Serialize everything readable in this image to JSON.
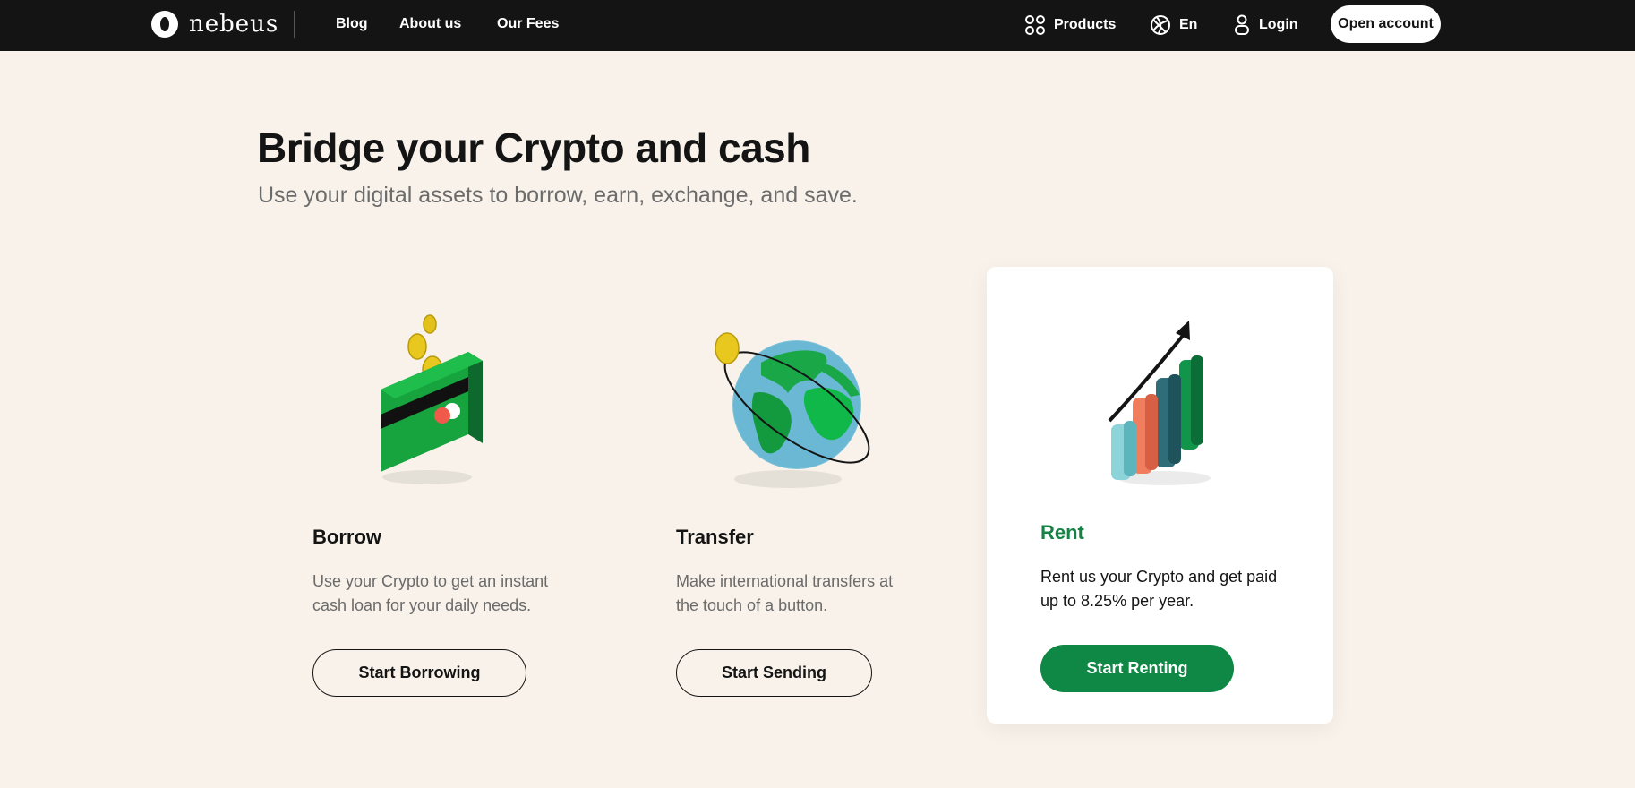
{
  "nav": {
    "logo_text": "nebeus",
    "links": [
      "Blog",
      "About us",
      "Our Fees"
    ],
    "products_label": "Products",
    "language_label": "En",
    "login_label": "Login",
    "open_account_label": "Open account"
  },
  "hero": {
    "title": "Bridge your Crypto and cash",
    "subtitle": "Use your digital assets to borrow, earn, exchange, and save."
  },
  "cards": [
    {
      "title": "Borrow",
      "description_line1": "Use your Crypto to get an instant",
      "description_line2": "cash loan for your daily needs.",
      "button_label": "Start Borrowing",
      "icon": "wallet-coins-icon"
    },
    {
      "title": "Transfer",
      "description_line1": "Make international transfers at",
      "description_line2": "the touch of a button.",
      "button_label": "Start Sending",
      "icon": "globe-icon"
    },
    {
      "title": "Rent",
      "description_line1": "Rent us your Crypto and get paid",
      "description_line2": "up to 8.25% per year.",
      "button_label": "Start Renting",
      "icon": "growth-chart-icon"
    }
  ],
  "colors": {
    "background": "#f8f2ea",
    "nav_bg": "#141414",
    "accent_green": "#0f8745",
    "rent_title_green": "#168246"
  }
}
